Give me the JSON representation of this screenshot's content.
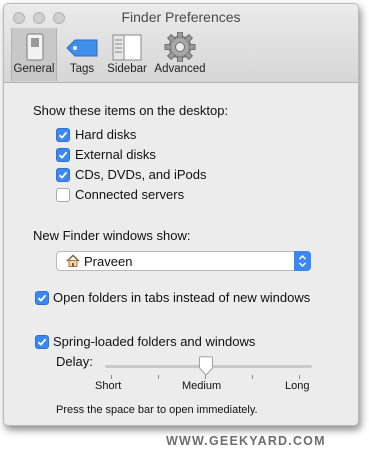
{
  "window": {
    "title": "Finder Preferences"
  },
  "toolbar": {
    "tabs": [
      {
        "label": "General",
        "icon": "general-switch-icon",
        "selected": true
      },
      {
        "label": "Tags",
        "icon": "tag-icon",
        "selected": false
      },
      {
        "label": "Sidebar",
        "icon": "sidebar-icon",
        "selected": false
      },
      {
        "label": "Advanced",
        "icon": "gear-icon",
        "selected": false
      }
    ]
  },
  "desktop": {
    "heading": "Show these items on the desktop:",
    "items": [
      {
        "label": "Hard disks",
        "checked": true
      },
      {
        "label": "External disks",
        "checked": true
      },
      {
        "label": "CDs, DVDs, and iPods",
        "checked": true
      },
      {
        "label": "Connected servers",
        "checked": false
      }
    ]
  },
  "new_window": {
    "label": "New Finder windows show:",
    "value": "Praveen",
    "icon": "home-icon"
  },
  "open_in_tabs": {
    "label": "Open folders in tabs instead of new windows",
    "checked": true
  },
  "spring_loaded": {
    "label": "Spring-loaded folders and windows",
    "checked": true,
    "delay_label": "Delay:",
    "level": 0.5,
    "ticks": [
      "Short",
      "Medium",
      "Long"
    ],
    "hint": "Press the space bar to open immediately."
  },
  "watermark": "WWW.GEEKYARD.COM",
  "colors": {
    "accent": "#3b89f0",
    "window_bg": "#ececec",
    "toolbar_bg": "#d6d6d6"
  }
}
